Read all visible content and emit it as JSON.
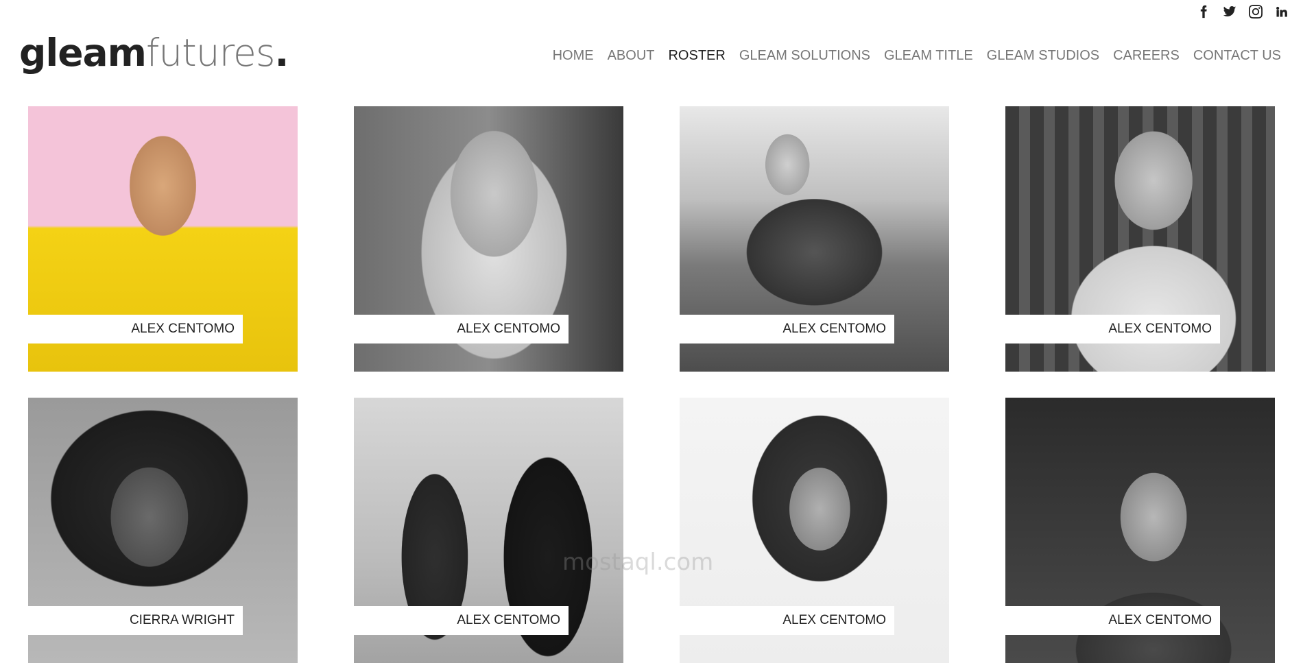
{
  "brand": {
    "part1": "gleam",
    "part2": "futures",
    "dot": "."
  },
  "social": [
    "facebook-icon",
    "twitter-icon",
    "instagram-icon",
    "linkedin-icon"
  ],
  "nav": [
    {
      "label": "HOME"
    },
    {
      "label": "ABOUT"
    },
    {
      "label": "ROSTER",
      "active": true
    },
    {
      "label": "GLEAM SOLUTIONS"
    },
    {
      "label": "GLEAM TITLE"
    },
    {
      "label": "GLEAM STUDIOS"
    },
    {
      "label": "CAREERS"
    },
    {
      "label": "CONTACT US"
    }
  ],
  "roster": [
    {
      "name": "ALEX CENTOMO"
    },
    {
      "name": "ALEX CENTOMO"
    },
    {
      "name": "ALEX CENTOMO"
    },
    {
      "name": "ALEX CENTOMO"
    },
    {
      "name": "CIERRA WRIGHT"
    },
    {
      "name": "ALEX CENTOMO"
    },
    {
      "name": "ALEX CENTOMO"
    },
    {
      "name": "ALEX CENTOMO"
    }
  ],
  "watermark": "mostaql.com"
}
